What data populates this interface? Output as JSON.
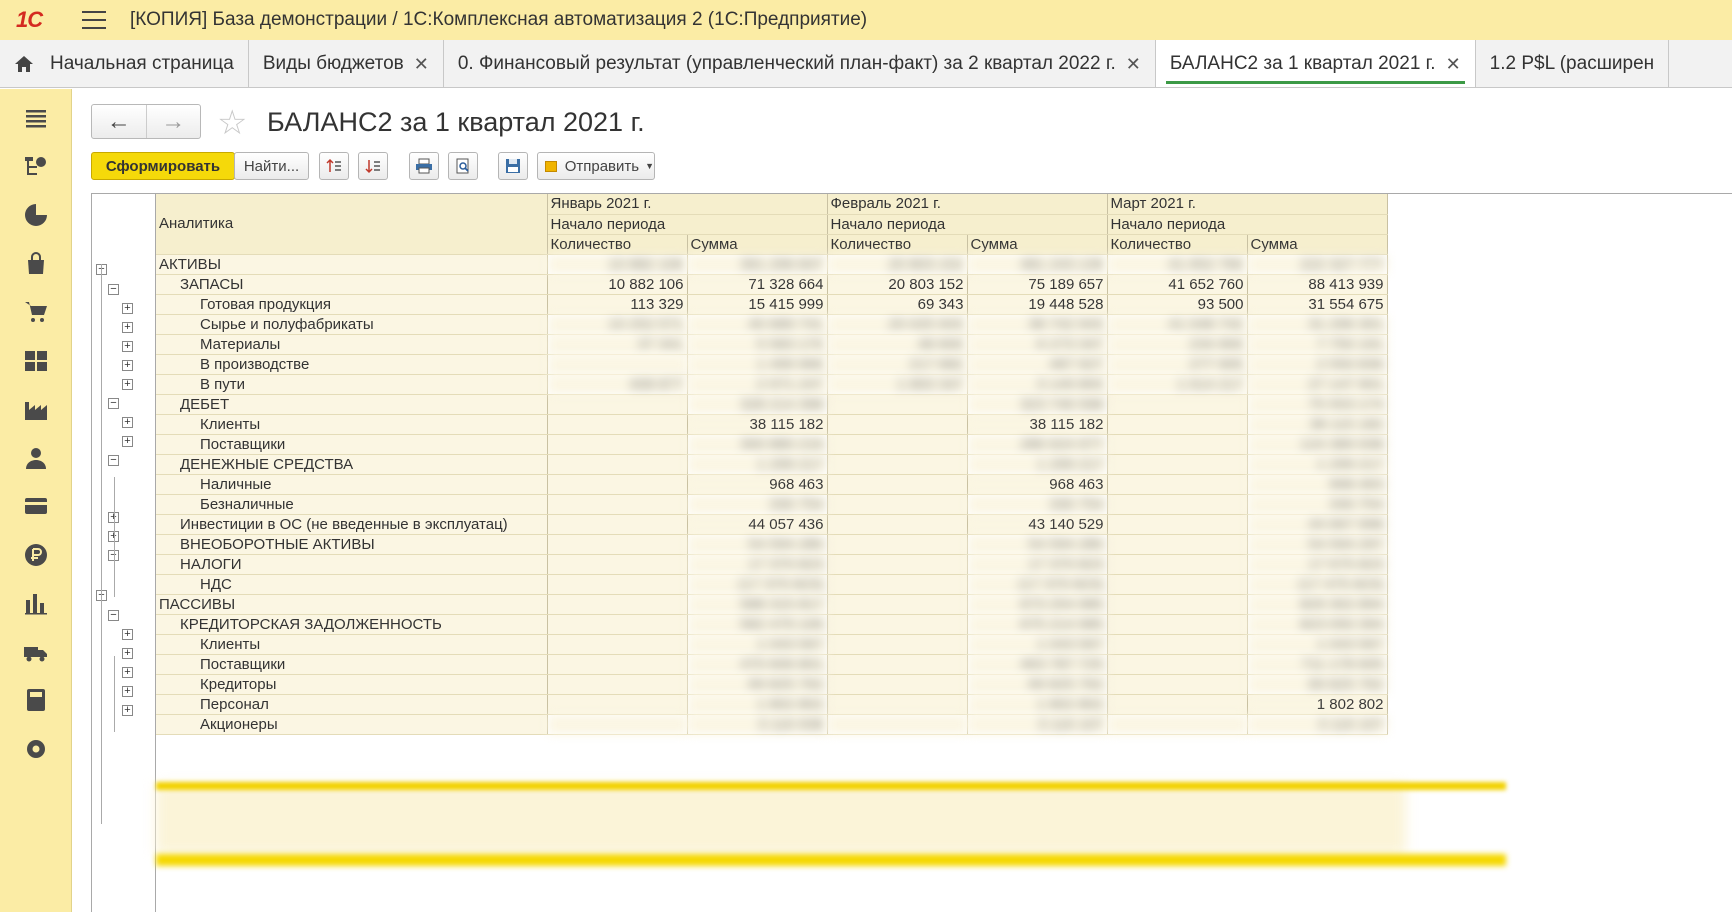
{
  "titlebar": {
    "logo": "1С",
    "title": "[КОПИЯ] База демонстрации / 1С:Комплексная автоматизация 2  (1С:Предприятие)"
  },
  "tabs": [
    {
      "label": "Начальная страница",
      "closable": false,
      "active": false,
      "icon": "home-icon"
    },
    {
      "label": "Виды  бюджетов",
      "closable": true,
      "active": false
    },
    {
      "label": "0. Финансовый результат (управленческий план-факт)  за 2 квартал 2022 г.",
      "closable": true,
      "active": false
    },
    {
      "label": "БАЛАНС2  за 1 квартал 2021 г.",
      "closable": true,
      "active": true
    },
    {
      "label": "1.2 P$L (расширен",
      "closable": false,
      "active": false
    }
  ],
  "sidebar": [
    "menu-icon",
    "org-structure-icon",
    "pie-chart-icon",
    "shopping-bag-icon",
    "cart-icon",
    "grid-icon",
    "factory-icon",
    "person-icon",
    "card-icon",
    "ruble-icon",
    "bar-chart-icon",
    "truck-icon",
    "calculator-icon",
    "gear-icon"
  ],
  "form": {
    "title": "БАЛАНС2  за 1 квартал 2021 г.",
    "toolbar": {
      "generate": "Сформировать",
      "find": "Найти...",
      "send": "Отправить"
    }
  },
  "table": {
    "header": {
      "analytics": "Аналитика",
      "months": [
        "Январь 2021 г.",
        "Февраль 2021 г.",
        "Март 2021 г."
      ],
      "period": "Начало периода",
      "qty": "Количество",
      "sum": "Сумма"
    },
    "rows": [
      {
        "label": "АКТИВЫ",
        "level": 0,
        "toggle": "minus",
        "values": [
          "10 882 106",
          "391 296 847",
          "20 803 152",
          "481 243 139",
          "41 652 760",
          "222 327 777"
        ],
        "blur": [
          true,
          true,
          true,
          true,
          true,
          true
        ]
      },
      {
        "label": "ЗАПАСЫ",
        "level": 1,
        "toggle": "minus",
        "values": [
          "10 882 106",
          "71 328 664",
          "20 803 152",
          "75 189 657",
          "41 652 760",
          "88 413 939"
        ],
        "blur": [
          false,
          false,
          false,
          false,
          false,
          false
        ]
      },
      {
        "label": "Готовая продукция",
        "level": 2,
        "toggle": "plus",
        "values": [
          "113 329",
          "15 415 999",
          "69 343",
          "19 448 528",
          "93 500",
          "31 554 675"
        ],
        "blur": [
          false,
          false,
          false,
          false,
          false,
          false
        ]
      },
      {
        "label": "Сырье и полуфабрикаты",
        "level": 2,
        "toggle": "plus",
        "values": [
          "10 252 571",
          "40 689 741",
          "20 025 943",
          "38 742 943",
          "41 048 742",
          "31 296 301"
        ],
        "blur": [
          true,
          true,
          true,
          true,
          true,
          true
        ]
      },
      {
        "label": "Материалы",
        "level": 2,
        "toggle": "plus",
        "values": [
          "37 341",
          "5 583 170",
          "48 600",
          "6 273 347",
          "234 900",
          "7 750 191"
        ],
        "blur": [
          true,
          true,
          true,
          true,
          true,
          true
        ]
      },
      {
        "label": "В производстве",
        "level": 2,
        "toggle": "plus",
        "values": [
          "",
          "1 499 966",
          "217 682",
          "487 927",
          "277 905",
          "2 550 836"
        ],
        "blur": [
          true,
          true,
          true,
          true,
          true,
          true
        ]
      },
      {
        "label": "В пути",
        "level": 2,
        "toggle": "plus",
        "values": [
          "408 877",
          "2 971 247",
          "1 893 347",
          "3 149 893",
          "1 614 217",
          "27 147 901"
        ],
        "blur": [
          true,
          true,
          true,
          true,
          true,
          true
        ]
      },
      {
        "label": "ДЕБЕТ",
        "level": 1,
        "toggle": "minus",
        "values": [
          "",
          "328 214 398",
          "",
          "323 746 598",
          "",
          "75 553 174"
        ],
        "blur": [
          false,
          true,
          false,
          true,
          false,
          true
        ]
      },
      {
        "label": "Клиенты",
        "level": 2,
        "toggle": "plus",
        "values": [
          "",
          "38 115 182",
          "",
          "38 115 182",
          "",
          "38 115 182"
        ],
        "blur": [
          false,
          false,
          false,
          false,
          false,
          true
        ]
      },
      {
        "label": "Поставщики",
        "level": 2,
        "toggle": "plus",
        "values": [
          "",
          "300 880 216",
          "",
          "286 624 977",
          "",
          "124 389 938"
        ],
        "blur": [
          false,
          true,
          false,
          true,
          false,
          true
        ]
      },
      {
        "label": "ДЕНЕЖНЫЕ СРЕДСТВА",
        "level": 1,
        "toggle": "minus",
        "values": [
          "",
          "1 299 217",
          "",
          "1 299 217",
          "",
          "1 299 217"
        ],
        "blur": [
          false,
          true,
          false,
          true,
          false,
          true
        ]
      },
      {
        "label": "Наличные",
        "level": 2,
        "toggle": "none",
        "values": [
          "",
          "968 463",
          "",
          "968 463",
          "",
          "968 463"
        ],
        "blur": [
          false,
          false,
          false,
          false,
          false,
          true
        ]
      },
      {
        "label": "Безналичные",
        "level": 2,
        "toggle": "none",
        "values": [
          "",
          "330 754",
          "",
          "330 754",
          "",
          "330 754"
        ],
        "blur": [
          false,
          true,
          false,
          true,
          false,
          true
        ]
      },
      {
        "label": "Инвестиции в ОС (не введенные в эксплуатац)",
        "level": 1,
        "toggle": "plus",
        "values": [
          "",
          "44 057 436",
          "",
          "43 140 529",
          "",
          "44 667 998"
        ],
        "blur": [
          false,
          false,
          false,
          false,
          false,
          true
        ]
      },
      {
        "label": "ВНЕОБОРОТНЫЕ АКТИВЫ",
        "level": 1,
        "toggle": "plus",
        "values": [
          "",
          "54 594 280",
          "",
          "54 594 280",
          "",
          "54 594 297"
        ],
        "blur": [
          false,
          true,
          false,
          true,
          false,
          true
        ]
      },
      {
        "label": "НАЛОГИ",
        "level": 1,
        "toggle": "minus",
        "values": [
          "",
          "17 370 823",
          "",
          "17 370 823",
          "",
          "17 675 823"
        ],
        "blur": [
          false,
          true,
          false,
          true,
          false,
          true
        ]
      },
      {
        "label": "НДС",
        "level": 2,
        "toggle": "none",
        "values": [
          "",
          "(17 370 823)",
          "",
          "(17 370 823)",
          "",
          "(17 475 823)"
        ],
        "blur": [
          false,
          true,
          false,
          true,
          false,
          true
        ]
      },
      {
        "label": "ПАССИВЫ",
        "level": 0,
        "toggle": "minus",
        "values": [
          "",
          "588 315 817",
          "",
          "673 254 985",
          "",
          "829 302 894"
        ],
        "blur": [
          false,
          true,
          false,
          true,
          false,
          true
        ]
      },
      {
        "label": "КРЕДИТОРСКАЯ ЗАДОЛЖЕННОСТЬ",
        "level": 1,
        "toggle": "minus",
        "values": [
          "",
          "582 479 106",
          "",
          "675 214 985",
          "",
          "823 050 394"
        ],
        "blur": [
          false,
          true,
          false,
          true,
          false,
          true
        ]
      },
      {
        "label": "Клиенты",
        "level": 2,
        "toggle": "plus",
        "values": [
          "",
          "1 043 567",
          "",
          "1 043 567",
          "",
          "1 043 567"
        ],
        "blur": [
          false,
          true,
          false,
          true,
          false,
          true
        ]
      },
      {
        "label": "Поставщики",
        "level": 2,
        "toggle": "plus",
        "values": [
          "",
          "470 606 801",
          "",
          "463 787 725",
          "",
          "711 178 605"
        ],
        "blur": [
          false,
          true,
          false,
          true,
          false,
          true
        ]
      },
      {
        "label": "Кредиторы",
        "level": 2,
        "toggle": "plus",
        "values": [
          "",
          "69 825 762",
          "",
          "69 825 762",
          "",
          "69 825 762"
        ],
        "blur": [
          false,
          true,
          false,
          true,
          false,
          true
        ]
      },
      {
        "label": "Персонал",
        "level": 2,
        "toggle": "plus",
        "values": [
          "",
          "1 802 802",
          "",
          "1 802 802",
          "",
          "1 802 802"
        ],
        "blur": [
          false,
          true,
          false,
          true,
          false,
          false
        ]
      },
      {
        "label": "Акционеры",
        "level": 2,
        "toggle": "plus",
        "values": [
          "",
          "3 116 938",
          "",
          "3 116 107",
          "",
          "3 116 107"
        ],
        "blur": [
          true,
          true,
          true,
          true,
          true,
          true
        ]
      }
    ]
  }
}
